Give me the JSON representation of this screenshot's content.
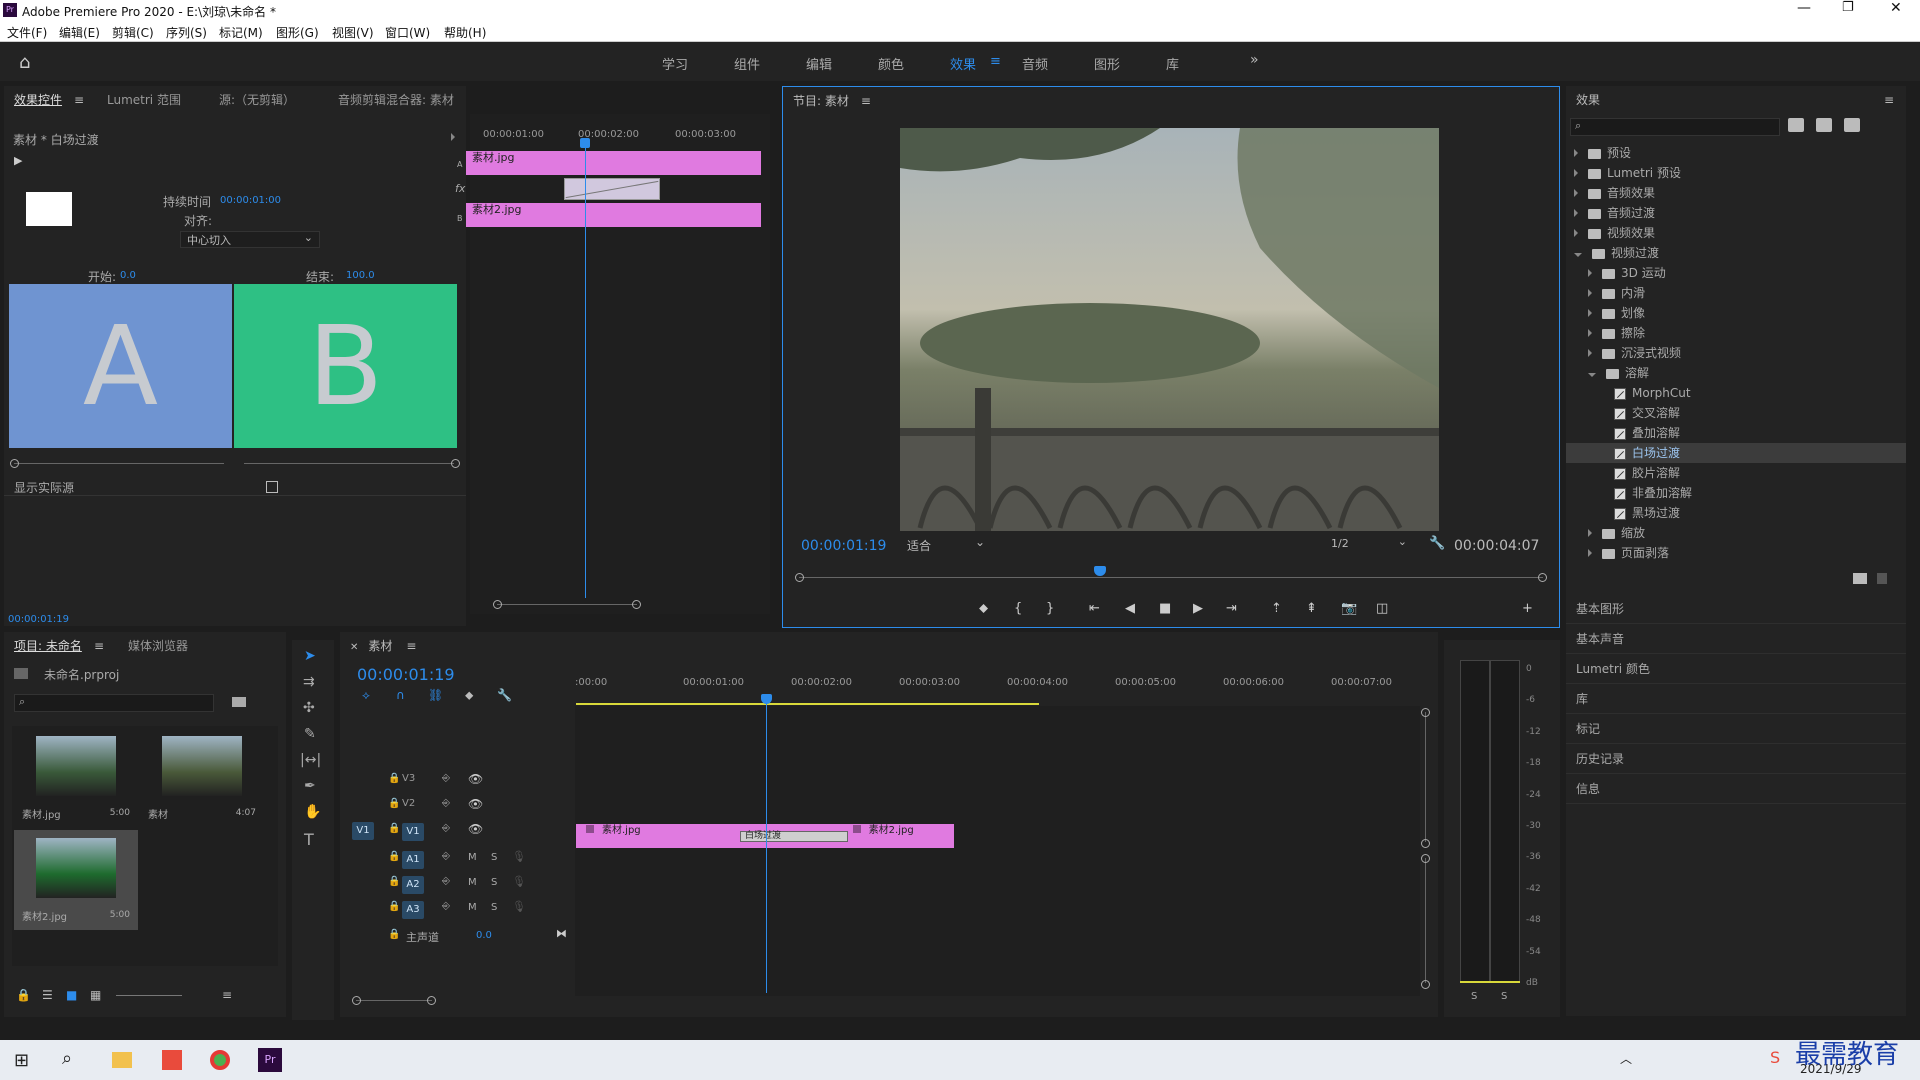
{
  "app": {
    "title": "Adobe Premiere Pro 2020 - E:\\刘琼\\未命名 *",
    "menu": [
      "文件(F)",
      "编辑(E)",
      "剪辑(C)",
      "序列(S)",
      "标记(M)",
      "图形(G)",
      "视图(V)",
      "窗口(W)",
      "帮助(H)"
    ]
  },
  "workspaces": [
    "学习",
    "组件",
    "编辑",
    "颜色",
    "效果",
    "音频",
    "图形",
    "库"
  ],
  "active_workspace": "效果",
  "effect_controls": {
    "tabs": [
      "效果控件",
      "Lumetri 范围",
      "源:（无剪辑）",
      "音频剪辑混合器: 素材"
    ],
    "clip_label": "素材 * 白场过渡",
    "duration_label": "持续时间",
    "duration_value": "00:00:01:00",
    "align_label": "对齐:",
    "align_value": "中心切入",
    "start_label": "开始:",
    "start_value": "0.0",
    "end_label": "结束:",
    "end_value": "100.0",
    "a_letter": "A",
    "b_letter": "B",
    "show_actual": "显示实际源",
    "ruler": [
      "00:00:01:00",
      "00:00:02:00",
      "00:00:03:00"
    ],
    "track_a_label": "A",
    "track_b_label": "B",
    "fx": "fx",
    "clip_a": "素材.jpg",
    "clip_b": "素材2.jpg",
    "timecode": "00:00:01:19"
  },
  "program": {
    "title": "节目: 素材",
    "timecode": "00:00:01:19",
    "fit": "适合",
    "quality": "1/2",
    "duration": "00:00:04:07"
  },
  "effects": {
    "title": "效果",
    "tree": [
      {
        "label": "预设",
        "level": 0,
        "type": "folder",
        "open": false
      },
      {
        "label": "Lumetri 预设",
        "level": 0,
        "type": "folder",
        "open": false
      },
      {
        "label": "音频效果",
        "level": 0,
        "type": "folder",
        "open": false
      },
      {
        "label": "音频过渡",
        "level": 0,
        "type": "folder",
        "open": false
      },
      {
        "label": "视频效果",
        "level": 0,
        "type": "folder",
        "open": false
      },
      {
        "label": "视频过渡",
        "level": 0,
        "type": "folder",
        "open": true
      },
      {
        "label": "3D 运动",
        "level": 1,
        "type": "folder",
        "open": false
      },
      {
        "label": "内滑",
        "level": 1,
        "type": "folder",
        "open": false
      },
      {
        "label": "划像",
        "level": 1,
        "type": "folder",
        "open": false
      },
      {
        "label": "擦除",
        "level": 1,
        "type": "folder",
        "open": false
      },
      {
        "label": "沉浸式视频",
        "level": 1,
        "type": "folder",
        "open": false
      },
      {
        "label": "溶解",
        "level": 1,
        "type": "folder",
        "open": true
      },
      {
        "label": "MorphCut",
        "level": 2,
        "type": "fx"
      },
      {
        "label": "交叉溶解",
        "level": 2,
        "type": "fx"
      },
      {
        "label": "叠加溶解",
        "level": 2,
        "type": "fx"
      },
      {
        "label": "白场过渡",
        "level": 2,
        "type": "fx",
        "selected": true
      },
      {
        "label": "胶片溶解",
        "level": 2,
        "type": "fx"
      },
      {
        "label": "非叠加溶解",
        "level": 2,
        "type": "fx"
      },
      {
        "label": "黑场过渡",
        "level": 2,
        "type": "fx"
      },
      {
        "label": "缩放",
        "level": 1,
        "type": "folder",
        "open": false
      },
      {
        "label": "页面剥落",
        "level": 1,
        "type": "folder",
        "open": false
      }
    ],
    "panels": [
      "基本图形",
      "基本声音",
      "Lumetri 颜色",
      "库",
      "标记",
      "历史记录",
      "信息"
    ]
  },
  "project": {
    "tabs": [
      "项目: 未命名",
      "媒体浏览器"
    ],
    "file": "未命名.prproj",
    "items": [
      {
        "name": "素材.jpg",
        "dur": "5:00"
      },
      {
        "name": "素材",
        "dur": "4:07"
      },
      {
        "name": "素材2.jpg",
        "dur": "5:00"
      }
    ]
  },
  "timeline": {
    "tab": "素材",
    "timecode": "00:00:01:19",
    "ruler": [
      ":00:00",
      "00:00:01:00",
      "00:00:02:00",
      "00:00:03:00",
      "00:00:04:00",
      "00:00:05:00",
      "00:00:06:00",
      "00:00:07:00"
    ],
    "video_tracks": [
      "V3",
      "V2",
      "V1"
    ],
    "audio_tracks": [
      "A1",
      "A2",
      "A3"
    ],
    "source_patch_v": "V1",
    "master": "主声道",
    "master_val": "0.0",
    "m": "M",
    "s": "S",
    "clip1": "素材.jpg",
    "clip2": "素材2.jpg",
    "transition": "白场过渡"
  },
  "meter": {
    "labels": [
      "0",
      "-6",
      "-12",
      "-18",
      "-24",
      "-30",
      "-36",
      "-42",
      "-48",
      "-54",
      "dB"
    ],
    "s": "S"
  },
  "taskbar": {
    "date": "2021/9/29",
    "watermark": "最需教育"
  }
}
